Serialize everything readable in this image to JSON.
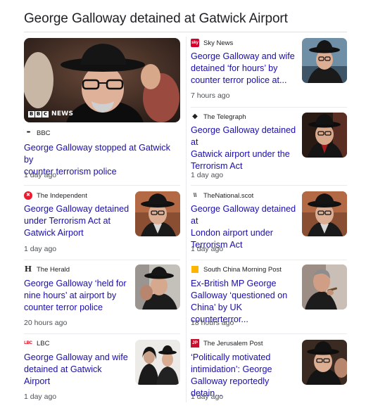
{
  "heading": "George Galloway detained at Gatwick Airport",
  "featured_overlay": {
    "letters": [
      "B",
      "B",
      "C"
    ],
    "word": "NEWS"
  },
  "left": [
    {
      "source": "BBC",
      "icon": "bbc-dots-icon",
      "title_lines": [
        "George Galloway stopped at Gatwick by",
        "counter terrorism police"
      ],
      "time": "1 day ago"
    },
    {
      "source": "The Independent",
      "icon": "independent-eagle-icon",
      "title_lines": [
        "George Galloway detained",
        "under Terrorism Act at",
        "Gatwick Airport"
      ],
      "time": "1 day ago"
    },
    {
      "source": "The Herald",
      "icon": "herald-h-icon",
      "title_lines": [
        "George Galloway ‘held for",
        "nine hours’ at airport by",
        "counter terror police"
      ],
      "time": "20 hours ago"
    },
    {
      "source": "LBC",
      "icon": "lbc-icon",
      "title_lines": [
        "George Galloway and wife",
        "detained at Gatwick Airport"
      ],
      "time": "1 day ago"
    }
  ],
  "right": [
    {
      "source": "Sky News",
      "icon": "sky-news-icon",
      "title_lines": [
        "George Galloway and wife",
        "detained ‘for hours’ by",
        "counter terror police at..."
      ],
      "time": "7 hours ago"
    },
    {
      "source": "The Telegraph",
      "icon": "telegraph-diamond-icon",
      "title_lines": [
        "George Galloway detained at",
        "Gatwick airport under the",
        "Terrorism Act"
      ],
      "time": "1 day ago"
    },
    {
      "source": "TheNational.scot",
      "icon": "national-scot-icon",
      "title_lines": [
        "George Galloway detained at",
        "London airport under",
        "Terrorism Act"
      ],
      "time": "1 day ago"
    },
    {
      "source": "South China Morning Post",
      "icon": "scmp-icon",
      "title_lines": [
        "Ex-British MP George",
        "Galloway ‘questioned on",
        "China’ by UK counterterror..."
      ],
      "time": "18 hours ago"
    },
    {
      "source": "The Jerusalem Post",
      "icon": "jpost-icon",
      "title_lines": [
        "‘Politically motivated",
        "intimidation’: George",
        "Galloway reportedly detain..."
      ],
      "time": "1 day ago"
    }
  ],
  "favicons": {
    "bbc": "•••",
    "independent": "✖",
    "herald": "H",
    "lbc": "LBC",
    "sky": "sky",
    "telegraph": "◆",
    "national": "\\\\",
    "scmp": "",
    "jpost": "JP"
  },
  "colors": {
    "link": "#1a0dab",
    "meta": "#4d5156",
    "divider": "#e8eaed"
  }
}
